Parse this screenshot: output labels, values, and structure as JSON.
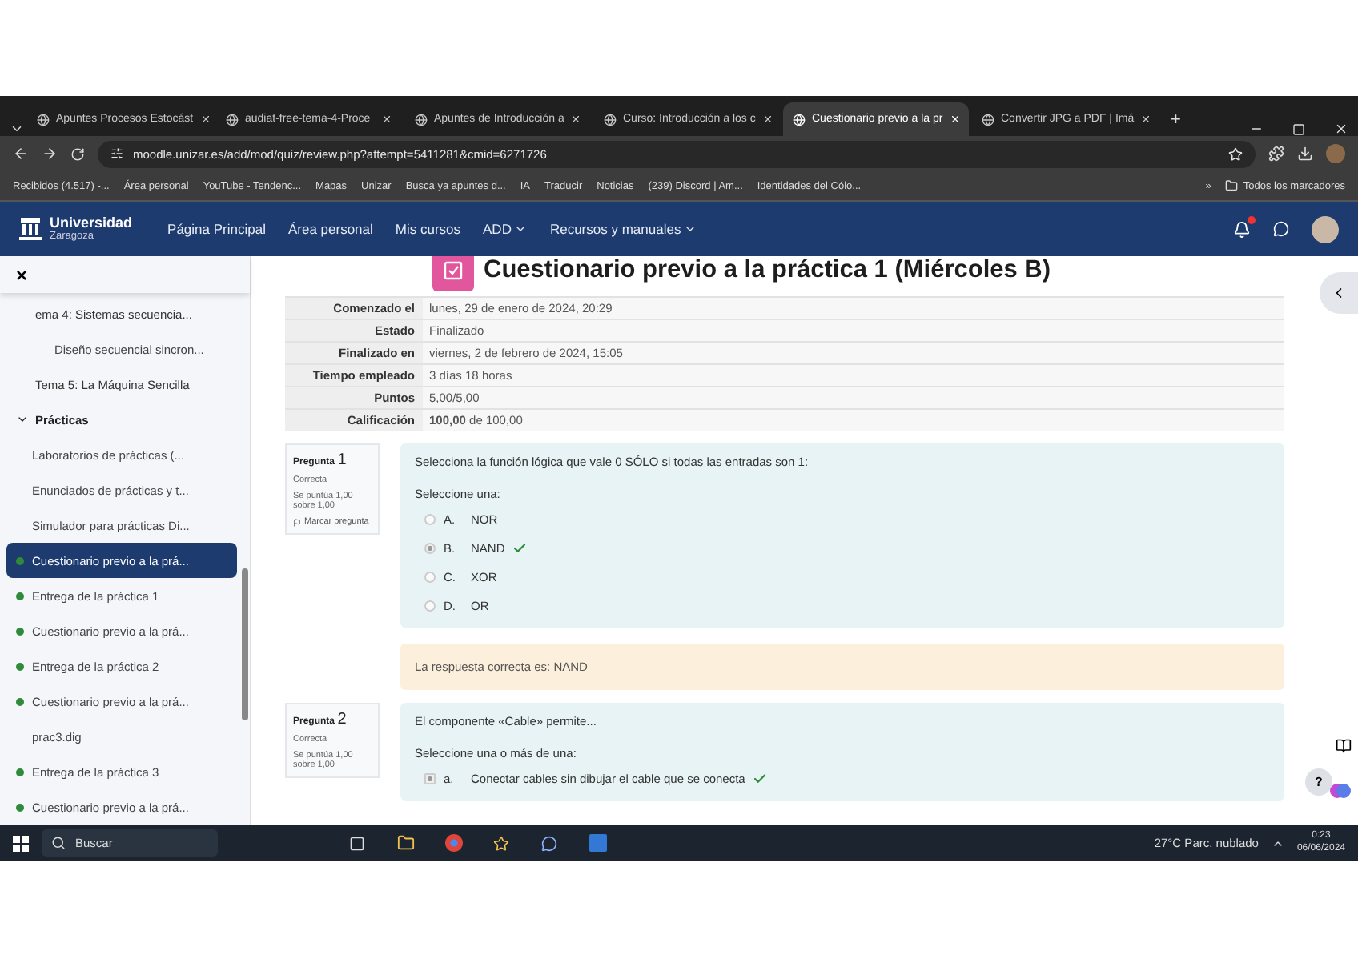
{
  "browser": {
    "tabs": [
      {
        "title": "Apuntes Procesos Estocást",
        "selected": false
      },
      {
        "title": "audiat-free-tema-4-Proce",
        "selected": false
      },
      {
        "title": "Apuntes de Introducción a",
        "selected": false
      },
      {
        "title": "Curso: Introducción a los c",
        "selected": false
      },
      {
        "title": "Cuestionario previo a la pr",
        "selected": true
      },
      {
        "title": "Convertir JPG a PDF | Imá",
        "selected": false
      }
    ],
    "new_tab": "+",
    "address": "moodle.unizar.es/add/mod/quiz/review.php?attempt=5411281&cmid=6271726",
    "bookmarks": [
      {
        "label": "Recibidos (4.517) -..."
      },
      {
        "label": "Área personal"
      },
      {
        "label": "YouTube - Tendenc..."
      },
      {
        "label": "Mapas"
      },
      {
        "label": "Unizar"
      },
      {
        "label": "Busca ya apuntes d..."
      },
      {
        "label": "IA"
      },
      {
        "label": "Traducir"
      },
      {
        "label": "Noticias"
      },
      {
        "label": "(239) Discord | Am..."
      },
      {
        "label": "Identidades del Cólo..."
      }
    ],
    "more": "»",
    "all_bookmarks": "Todos los marcadores"
  },
  "site": {
    "brand": {
      "name": "Universidad",
      "sub": "Zaragoza"
    },
    "nav": [
      {
        "label": "Página Principal",
        "dropdown": false
      },
      {
        "label": "Área personal",
        "dropdown": false
      },
      {
        "label": "Mis cursos",
        "dropdown": false
      },
      {
        "label": "ADD",
        "dropdown": true
      },
      {
        "label": "Recursos y manuales",
        "dropdown": true
      }
    ],
    "notifications": true
  },
  "sidebar": {
    "close": "×",
    "items": [
      {
        "label": "ema 4: Sistemas secuencia...",
        "expanded": false,
        "children": [
          {
            "label": "Diseño secuencial sincron...",
            "selected": false
          }
        ]
      },
      {
        "label": "Tema 5: La Máquina Sencilla",
        "expanded": false
      },
      {
        "label": "Prácticas",
        "expanded": true,
        "children": [
          {
            "label": "Laboratorios de prácticas (...",
            "completed": false,
            "selected": false
          },
          {
            "label": "Enunciados de prácticas y t...",
            "completed": false,
            "selected": false
          },
          {
            "label": "Simulador para prácticas Di...",
            "completed": false,
            "selected": false
          },
          {
            "label": "Cuestionario previo a la prá...",
            "completed": true,
            "selected": true
          },
          {
            "label": "Entrega de la práctica 1",
            "completed": true,
            "selected": false
          },
          {
            "label": "Cuestionario previo a la prá...",
            "completed": true,
            "selected": false
          },
          {
            "label": "Entrega de la práctica 2",
            "completed": true,
            "selected": false
          },
          {
            "label": "Cuestionario previo a la prá...",
            "completed": true,
            "selected": false
          },
          {
            "label": "prac3.dig",
            "completed": false,
            "selected": false
          },
          {
            "label": "Entrega de la práctica 3",
            "completed": true,
            "selected": false
          },
          {
            "label": "Cuestionario previo a la prá...",
            "completed": true,
            "selected": false
          }
        ]
      }
    ]
  },
  "page": {
    "title": "Cuestionario previo a la práctica 1 (Miércoles B)",
    "summary": [
      {
        "label": "Comenzado el",
        "value": "lunes, 29 de enero de 2024, 20:29"
      },
      {
        "label": "Estado",
        "value": "Finalizado"
      },
      {
        "label": "Finalizado en",
        "value": "viernes, 2 de febrero de 2024, 15:05"
      },
      {
        "label": "Tiempo empleado",
        "value": "3 días 18 horas"
      },
      {
        "label": "Puntos",
        "value": "5,00/5,00"
      },
      {
        "label": "Calificación",
        "value": "**100,00** de 100,00"
      }
    ],
    "questions": [
      {
        "heading": "Pregunta",
        "number": "1",
        "status": "Correcta",
        "marks": "Se puntúa 1,00 sobre 1,00",
        "flag": "Marcar pregunta",
        "text": "Selecciona la función lógica que vale 0 SÓLO si todas las entradas son 1:",
        "prompt": "Seleccione una:",
        "kind": "radio",
        "options": [
          {
            "letter": "A.",
            "label": "NOR",
            "selected": false
          },
          {
            "letter": "B.",
            "label": "NAND",
            "selected": true,
            "correct": true
          },
          {
            "letter": "C.",
            "label": "XOR",
            "selected": false
          },
          {
            "letter": "D.",
            "label": "OR",
            "selected": false
          }
        ],
        "feedback": "La respuesta correcta es: NAND"
      },
      {
        "heading": "Pregunta",
        "number": "2",
        "status": "Correcta",
        "marks": "Se puntúa 1,00 sobre 1,00",
        "text": "El componente «Cable» permite...",
        "prompt": "Seleccione una o más de una:",
        "kind": "checkbox",
        "options": [
          {
            "letter": "a.",
            "label": "Conectar cables sin dibujar el cable que se conecta",
            "selected": true,
            "correct": true
          }
        ]
      }
    ]
  },
  "help": "?",
  "taskbar": {
    "search": "Buscar",
    "weather": "27°C Parc. nublado",
    "time": "0:23",
    "date": "06/06/2024"
  }
}
